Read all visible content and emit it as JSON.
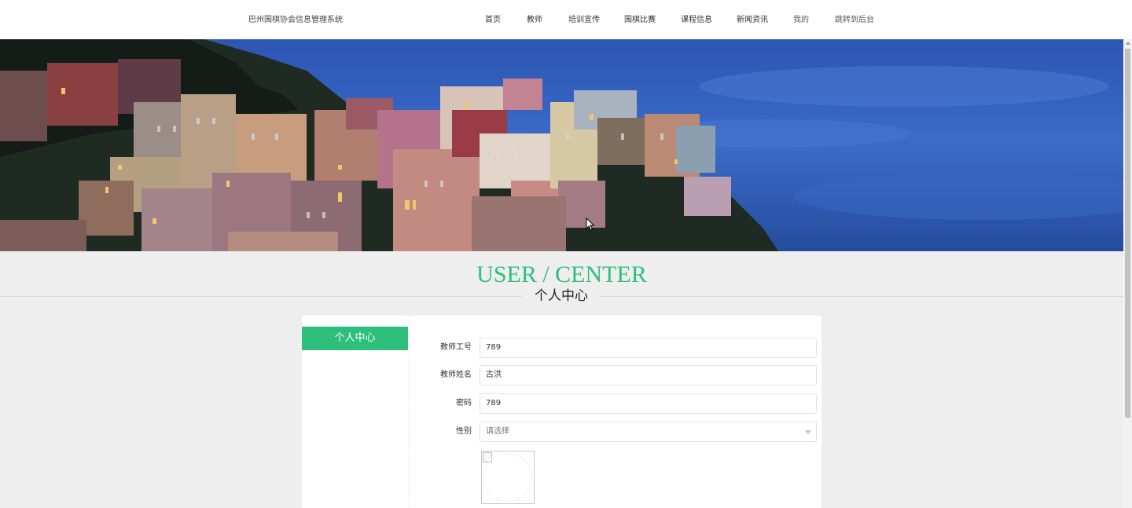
{
  "header": {
    "site_title": "巴州围棋协会信息管理系统",
    "nav": [
      {
        "label": "首页"
      },
      {
        "label": "教师"
      },
      {
        "label": "培训宣传"
      },
      {
        "label": "围棋比赛"
      },
      {
        "label": "课程信息"
      },
      {
        "label": "新闻资讯"
      },
      {
        "label": "我的"
      },
      {
        "label": "跳转到后台"
      }
    ]
  },
  "section": {
    "title_en": "USER / CENTER",
    "title_cn": "个人中心"
  },
  "sidebar": {
    "items": [
      {
        "label": "个人中心",
        "active": true
      }
    ]
  },
  "form": {
    "fields": [
      {
        "label": "教师工号",
        "value": "789"
      },
      {
        "label": "教师姓名",
        "value": "古洪"
      },
      {
        "label": "密码",
        "value": "789"
      },
      {
        "label": "性别",
        "placeholder": "请选择"
      }
    ]
  },
  "colors": {
    "accent": "#2fbf7d",
    "page_bg": "#eeeeef"
  }
}
